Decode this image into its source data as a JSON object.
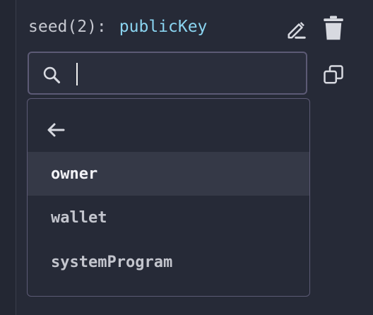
{
  "seed": {
    "label": "seed(2):",
    "type": "publicKey"
  },
  "search": {
    "value": "",
    "placeholder": ""
  },
  "dropdown": {
    "options": [
      {
        "label": "owner"
      },
      {
        "label": "wallet"
      },
      {
        "label": "systemProgram"
      }
    ],
    "active_index": 0
  },
  "icons": {
    "edit": "edit-pencil-icon",
    "delete": "trash-icon",
    "copy": "copy-icon",
    "search": "search-icon",
    "back": "arrow-left-icon"
  },
  "colors": {
    "background": "#262a37",
    "type_accent": "#8ad4f0",
    "border": "#5c5a75",
    "active_row": "#353947"
  }
}
